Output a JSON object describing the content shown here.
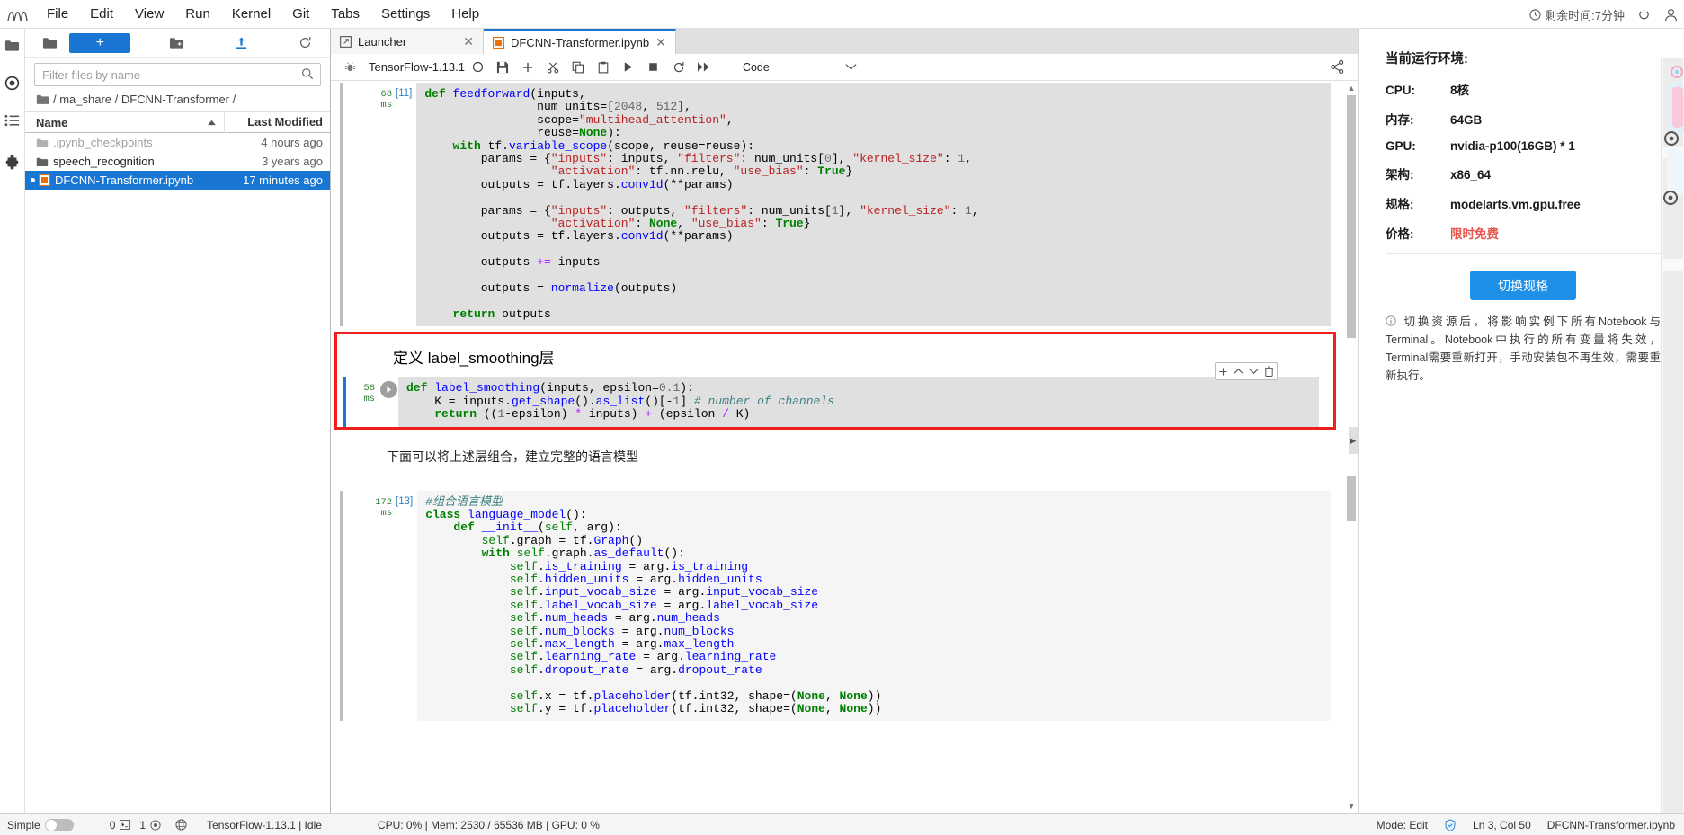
{
  "menubar": {
    "logo": "jupyter-logo-icon",
    "items": [
      "File",
      "Edit",
      "View",
      "Run",
      "Kernel",
      "Git",
      "Tabs",
      "Settings",
      "Help"
    ],
    "time_left": "剩余时间:7分钟",
    "power_icon": "power-icon",
    "user_icon": "user-account-icon"
  },
  "rail": {
    "items": [
      {
        "name": "folder-icon",
        "label": "File Browser"
      },
      {
        "name": "running-terminals-icon",
        "label": "Running Terminals and Kernels"
      },
      {
        "name": "commands-list-icon",
        "label": "Commands"
      },
      {
        "name": "extension-puzzle-icon",
        "label": "Extension Manager"
      }
    ]
  },
  "filebrowser": {
    "toolbar": {
      "new_folder_icon": "new-folder-icon",
      "new_launcher_label": "+",
      "upload_icon": "upload-icon",
      "refresh_icon": "refresh-icon",
      "folder_icon": "folder-icon"
    },
    "filter_placeholder": "Filter files by name",
    "filter_value": "",
    "search_icon": "search-icon",
    "breadcrumb": "/ ma_share / DFCNN-Transformer /",
    "columns": [
      "Name",
      "Last Modified"
    ],
    "sort_icon": "sort-ascending-icon",
    "rows": [
      {
        "name": ".ipynb_checkpoints",
        "modified": "4 hours ago",
        "icon": "folder-icon",
        "type": "folder",
        "dim": true,
        "selected": false,
        "running": false
      },
      {
        "name": "speech_recognition",
        "modified": "3 years ago",
        "icon": "folder-icon",
        "type": "folder",
        "dim": false,
        "selected": false,
        "running": false
      },
      {
        "name": "DFCNN-Transformer.ipynb",
        "modified": "17 minutes ago",
        "icon": "notebook-icon",
        "type": "notebook",
        "dim": false,
        "selected": true,
        "running": true
      }
    ]
  },
  "tabs": [
    {
      "label": "Launcher",
      "icon": "launcher-icon",
      "active": false,
      "close_icon": "close-icon"
    },
    {
      "label": "DFCNN-Transformer.ipynb",
      "icon": "notebook-icon",
      "active": true,
      "close_icon": "close-icon"
    }
  ],
  "notebook_toolbar": {
    "bug_icon": "debug-bug-icon",
    "kernel_name": "TensorFlow-1.13.1",
    "kernel_status_icon": "kernel-idle-circle-icon",
    "buttons": [
      {
        "name": "save-button",
        "icon": "save-icon"
      },
      {
        "name": "insert-cell-button",
        "icon": "plus-icon"
      },
      {
        "name": "cut-cell-button",
        "icon": "scissors-icon"
      },
      {
        "name": "copy-cell-button",
        "icon": "copy-icon"
      },
      {
        "name": "paste-cell-button",
        "icon": "clipboard-icon"
      },
      {
        "name": "run-cell-button",
        "icon": "play-icon"
      },
      {
        "name": "interrupt-kernel-button",
        "icon": "stop-square-icon"
      },
      {
        "name": "restart-kernel-button",
        "icon": "restart-icon"
      },
      {
        "name": "restart-run-all-button",
        "icon": "fast-forward-icon"
      }
    ],
    "cell_type": "Code",
    "cell_type_caret": "chevron-down-icon",
    "share_icon": "share-icon"
  },
  "notebook": {
    "cells": [
      {
        "id": "cell-feedforward",
        "type": "code",
        "exec_time": "68\nms",
        "exec_time_value": "68",
        "exec_time_unit": "ms",
        "prompt": "[11]",
        "source": "def feedforward(inputs,\n                num_units=[2048, 512],\n                scope=\"multihead_attention\",\n                reuse=None):\n    with tf.variable_scope(scope, reuse=reuse):\n        params = {\"inputs\": inputs, \"filters\": num_units[0], \"kernel_size\": 1,\n                  \"activation\": tf.nn.relu, \"use_bias\": True}\n        outputs = tf.layers.conv1d(**params)\n\n        params = {\"inputs\": outputs, \"filters\": num_units[1], \"kernel_size\": 1,\n                  \"activation\": None, \"use_bias\": True}\n        outputs = tf.layers.conv1d(**params)\n\n        outputs += inputs\n\n        outputs = normalize(outputs)\n\n    return outputs"
      },
      {
        "id": "cell-md-heading",
        "type": "markdown",
        "source": "定义 label_smoothing层",
        "highlighted": true
      },
      {
        "id": "cell-label-smoothing",
        "type": "code",
        "exec_time_value": "58",
        "exec_time_unit": "ms",
        "prompt": "",
        "highlighted": true,
        "selected": true,
        "source": "def label_smoothing(inputs, epsilon=0.1):\n    K = inputs.get_shape().as_list()[-1] # number of channels\n    return ((1-epsilon) * inputs) + (epsilon / K)",
        "cell_toolbar": [
          "plus-icon",
          "chevron-up-icon",
          "chevron-down-icon",
          "trash-icon"
        ],
        "run_icon": "play-circle-icon"
      },
      {
        "id": "cell-md-text",
        "type": "markdown",
        "source": "下面可以将上述层组合，建立完整的语言模型"
      },
      {
        "id": "cell-language-model",
        "type": "code",
        "exec_time_value": "172",
        "exec_time_unit": "ms",
        "prompt": "[13]",
        "source": "#组合语言模型\nclass language_model():\n    def __init__(self, arg):\n        self.graph = tf.Graph()\n        with self.graph.as_default():\n            self.is_training = arg.is_training\n            self.hidden_units = arg.hidden_units\n            self.input_vocab_size = arg.input_vocab_size\n            self.label_vocab_size = arg.label_vocab_size\n            self.num_heads = arg.num_heads\n            self.num_blocks = arg.num_blocks\n            self.max_length = arg.max_length\n            self.learning_rate = arg.learning_rate\n            self.dropout_rate = arg.dropout_rate\n\n            self.x = tf.placeholder(tf.int32, shape=(None, None))\n            self.y = tf.placeholder(tf.int32, shape=(None, None))"
      }
    ]
  },
  "rightpanel": {
    "title": "当前运行环境:",
    "rows": [
      {
        "key": "CPU:",
        "value": "8核",
        "accent": false
      },
      {
        "key": "内存:",
        "value": "64GB",
        "accent": false
      },
      {
        "key": "GPU:",
        "value": "nvidia-p100(16GB) * 1",
        "accent": false
      },
      {
        "key": "架构:",
        "value": "x86_64",
        "accent": false
      },
      {
        "key": "规格:",
        "value": "modelarts.vm.gpu.free",
        "accent": false
      },
      {
        "key": "价格:",
        "value": "限时免费",
        "accent": true
      }
    ],
    "switch_button": "切换规格",
    "note_icon": "info-circle-icon",
    "note": "切换资源后，将影响实例下所有Notebook与Terminal。Notebook中执行的所有变量将失效，Terminal需要重新打开，手动安装包不再生效，需要重新执行。",
    "accent_color": "#e8554e",
    "brand_color": "#1e90e8"
  },
  "statusbar": {
    "simple_label": "Simple",
    "simple_toggle_on": false,
    "terminal_count": "0",
    "terminal_icon": "terminal-icon",
    "kernel_count": "1",
    "kernel_icon": "kernel-circle-icon",
    "globe_icon": "globe-icon",
    "kernel_status": "TensorFlow-1.13.1 | Idle",
    "resources": "CPU: 0% | Mem: 2530 / 65536 MB | GPU: 0 %",
    "mode": "Mode: Edit",
    "shield_icon": "shield-check-icon",
    "position": "Ln 3, Col 50",
    "filename": "DFCNN-Transformer.ipynb"
  }
}
